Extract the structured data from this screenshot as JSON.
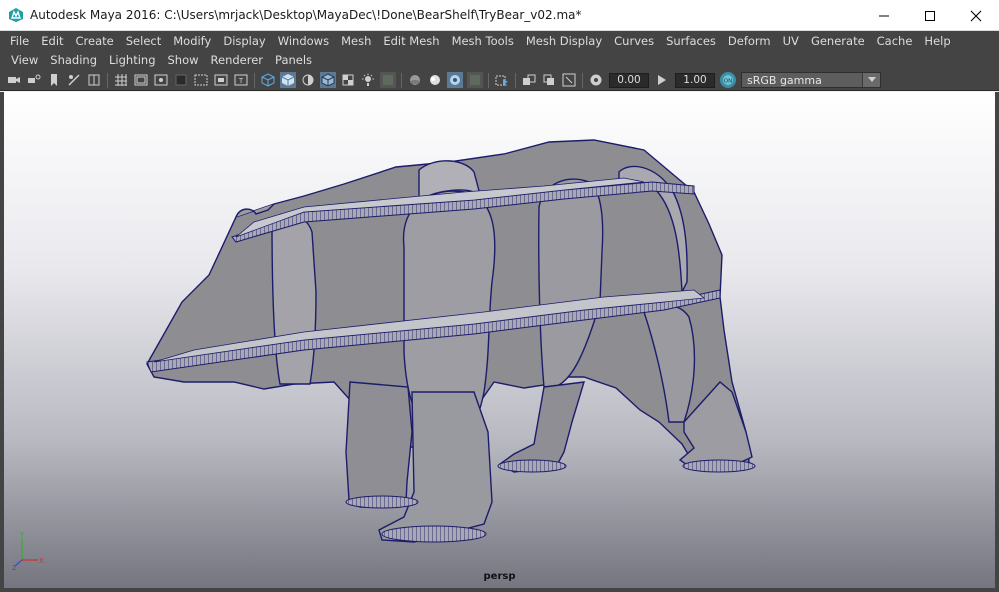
{
  "window": {
    "title": "Autodesk Maya 2016: C:\\Users\\mrjack\\Desktop\\MayaDec\\!Done\\BearShelf\\TryBear_v02.ma*",
    "controls": [
      "minimize-icon",
      "maximize-icon",
      "close-icon"
    ]
  },
  "menubar": {
    "items": [
      "File",
      "Edit",
      "Create",
      "Select",
      "Modify",
      "Display",
      "Windows",
      "Mesh",
      "Edit Mesh",
      "Mesh Tools",
      "Mesh Display",
      "Curves",
      "Surfaces",
      "Deform",
      "UV",
      "Generate",
      "Cache",
      "Help"
    ]
  },
  "panel_menu": {
    "items": [
      "View",
      "Shading",
      "Lighting",
      "Show",
      "Renderer",
      "Panels"
    ]
  },
  "toolbar": {
    "exposure_value": "0.00",
    "gamma_value": "1.00",
    "color_space": "sRGB gamma"
  },
  "viewport": {
    "camera": "persp",
    "axis_labels": [
      "X",
      "Y",
      "Z"
    ],
    "colors": {
      "mesh_fill": "#8f8f93",
      "wire": "#1e1e6e",
      "accent": "#4a8fd6"
    }
  }
}
